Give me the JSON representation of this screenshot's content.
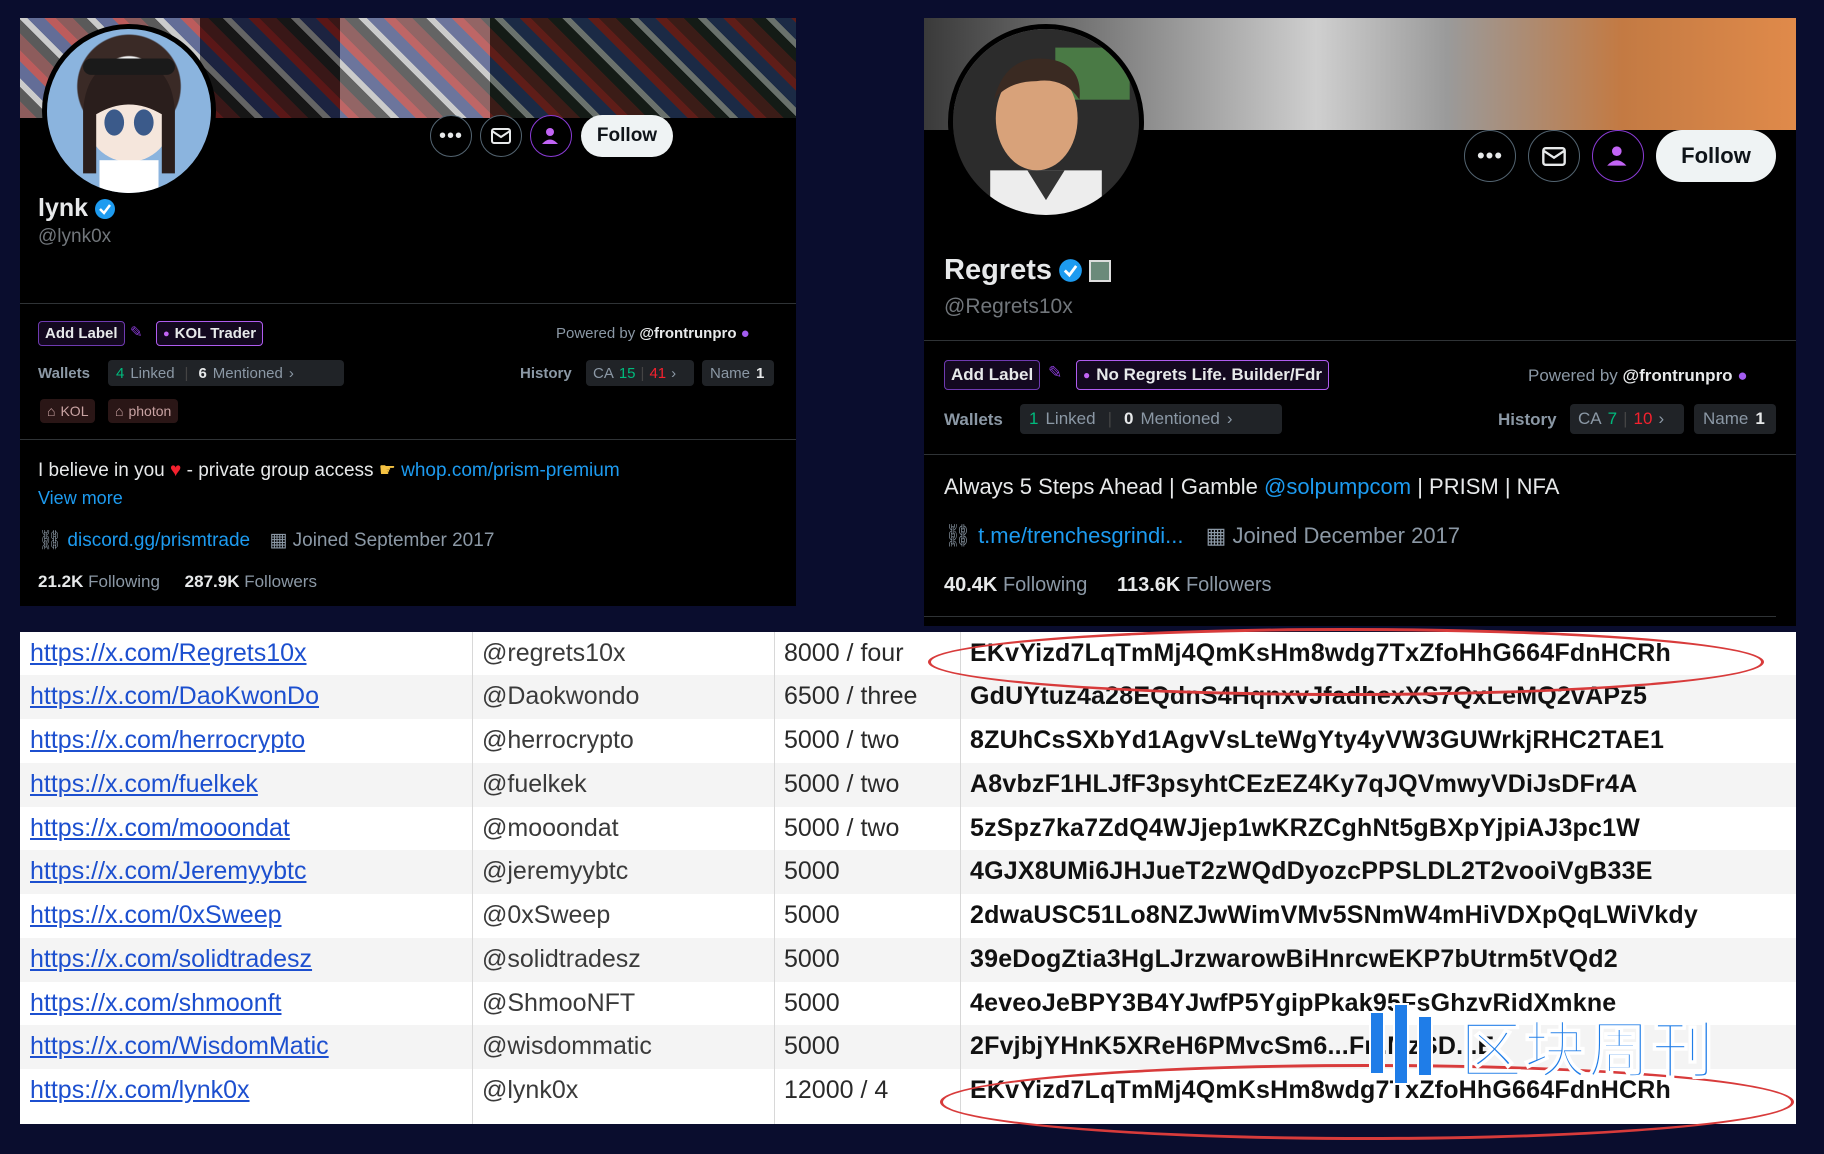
{
  "left_profile": {
    "name": "lynk",
    "handle": "@lynk0x",
    "follow_label": "Follow",
    "add_label": "Add Label",
    "chip_label": "KOL Trader",
    "powered_by_prefix": "Powered by",
    "powered_by_name": "@frontrunpro",
    "wallets_label": "Wallets",
    "linked_count": "4",
    "linked_label": "Linked",
    "mentioned_count": "6",
    "mentioned_label": "Mentioned",
    "history_label": "History",
    "ca_label": "CA",
    "ca_green": "15",
    "ca_red": "41",
    "name_label": "Name",
    "name_count": "1",
    "tags": [
      "KOL",
      "photon"
    ],
    "bio_text": "I believe in you",
    "bio_text2": "- private group access",
    "bio_link": "whop.com/prism-premium",
    "view_more": "View more",
    "website": "discord.gg/prismtrade",
    "joined": "Joined September 2017",
    "following_count": "21.2K",
    "following_label": "Following",
    "followers_count": "287.9K",
    "followers_label": "Followers"
  },
  "right_profile": {
    "name": "Regrets",
    "handle": "@Regrets10x",
    "follow_label": "Follow",
    "add_label": "Add Label",
    "chip_label": "No Regrets Life. Builder/Fdr",
    "powered_by_prefix": "Powered by",
    "powered_by_name": "@frontrunpro",
    "wallets_label": "Wallets",
    "linked_count": "1",
    "linked_label": "Linked",
    "mentioned_count": "0",
    "mentioned_label": "Mentioned",
    "history_label": "History",
    "ca_label": "CA",
    "ca_green": "7",
    "ca_red": "10",
    "name_label": "Name",
    "name_count": "1",
    "bio_text": "Always 5 Steps Ahead | Gamble",
    "bio_mention": "@solpumpcom",
    "bio_text2": "| PRISM | NFA",
    "website": "t.me/trenchesgrindi...",
    "joined": "Joined December 2017",
    "following_count": "40.4K",
    "following_label": "Following",
    "followers_count": "113.6K",
    "followers_label": "Followers"
  },
  "table": {
    "rows": [
      {
        "url": "https://x.com/Regrets10x",
        "handle": "@regrets10x",
        "amount": "8000 / four",
        "address": "EKvYizd7LqTmMj4QmKsHm8wdg7TxZfoHhG664FdnHCRh"
      },
      {
        "url": "https://x.com/DaoKwonDo",
        "handle": "@Daokwondo",
        "amount": "6500 / three",
        "address": "GdUYtuz4a28EQdnS4HqnxvJfadhexXS7QxLeMQ2vAPz5"
      },
      {
        "url": "https://x.com/herrocrypto",
        "handle": "@herrocrypto",
        "amount": "5000 / two",
        "address": "8ZUhCsSXbYd1AgvVsLteWgYty4yVW3GUWrkjRHC2TAE1"
      },
      {
        "url": "https://x.com/fuelkek",
        "handle": "@fuelkek",
        "amount": "5000 / two",
        "address": "A8vbzF1HLJfF3psyhtCEzEZ4Ky7qJQVmwyVDiJsDFr4A"
      },
      {
        "url": "https://x.com/mooondat",
        "handle": "@mooondat",
        "amount": "5000 / two",
        "address": "5zSpz7ka7ZdQ4WJjep1wKRZCghNt5gBXpYjpiAJ3pc1W"
      },
      {
        "url": "https://x.com/Jeremyybtc",
        "handle": "@jeremyybtc",
        "amount": "5000",
        "address": "4GJX8UMi6JHJueT2zWQdDyozcPPSLDL2T2vooiVgB33E"
      },
      {
        "url": "https://x.com/0xSweep",
        "handle": "@0xSweep",
        "amount": "5000",
        "address": "2dwaUSC51Lo8NZJwWimVMv5SNmW4mHiVDXpQqLWiVkdy"
      },
      {
        "url": "https://x.com/solidtradesz",
        "handle": "@solidtradesz",
        "amount": "5000",
        "address": "39eDogZtia3HgLJrzwarowBiHnrcwEKP7bUtrm5tVQd2"
      },
      {
        "url": "https://x.com/shmoonft",
        "handle": "@ShmooNFT",
        "amount": "5000",
        "address": "4eveoJeBPY3B4YJwfP5YgipPkak95FsGhzvRidXmkne"
      },
      {
        "url": "https://x.com/WisdomMatic",
        "handle": "@wisdommatic",
        "amount": "5000",
        "address": "2FvjbjYHnK5XReH6PMvcSm6...Fr..MzSD...E"
      },
      {
        "url": "https://x.com/lynk0x",
        "handle": "@lynk0x",
        "amount": "12000 / 4",
        "address": "EKvYizd7LqTmMj4QmKsHm8wdg7TxZfoHhG664FdnHCRh"
      }
    ]
  },
  "watermark": {
    "text": "区块周刊"
  },
  "colors": {
    "page_bg": "#0a0d2e",
    "verified": "#1d9bf0",
    "link": "#1d9bf0",
    "chip_border": "#b05cf0",
    "highlight_ellipse": "#d83b3b",
    "table_link": "#1c4fcf"
  }
}
